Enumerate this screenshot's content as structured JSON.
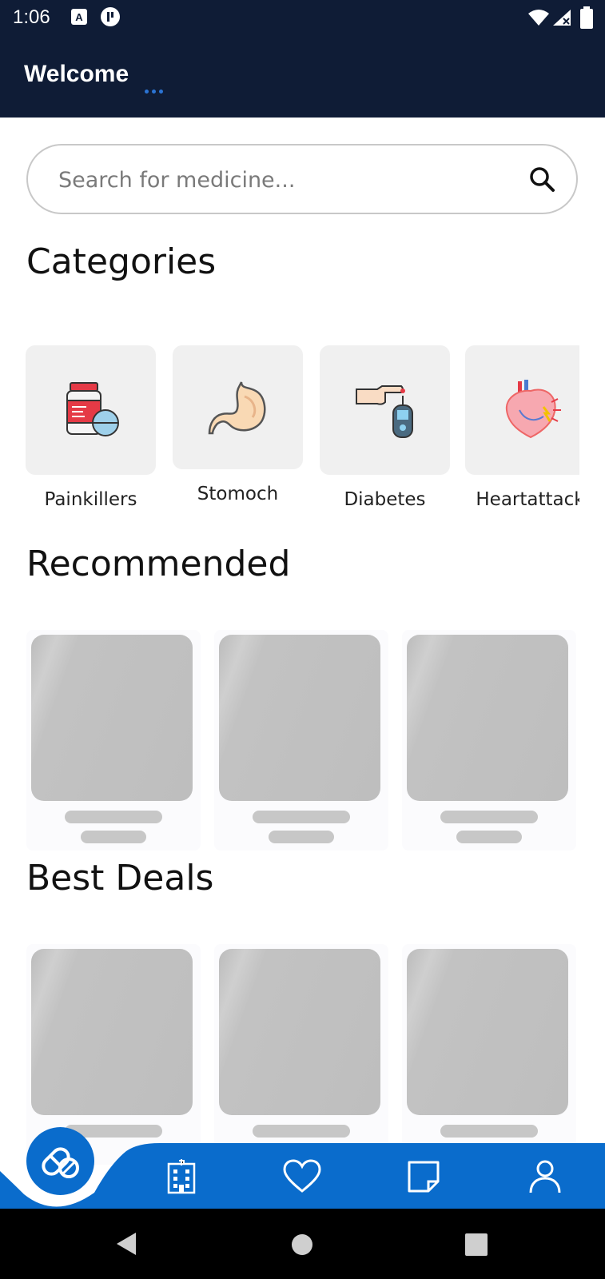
{
  "status_bar": {
    "time": "1:06"
  },
  "app_bar": {
    "title": "Welcome"
  },
  "search": {
    "placeholder": "Search for medicine..."
  },
  "sections": {
    "categories": "Categories",
    "recommended": "Recommended",
    "best_deals": "Best Deals"
  },
  "categories": [
    {
      "label": "Painkillers",
      "icon": "pill-bottle-icon"
    },
    {
      "label": "Stomoch",
      "icon": "stomach-icon"
    },
    {
      "label": "Diabetes",
      "icon": "glucose-meter-icon"
    },
    {
      "label": "Heartattack",
      "icon": "heart-organ-icon"
    }
  ],
  "bottom_nav": {
    "items": [
      "medicine-capsule-icon",
      "hospital-icon",
      "heart-icon",
      "note-icon",
      "profile-icon"
    ],
    "accent": "#0a6ccc"
  },
  "colors": {
    "header": "#0f1c36",
    "accent": "#0a6ccc"
  }
}
